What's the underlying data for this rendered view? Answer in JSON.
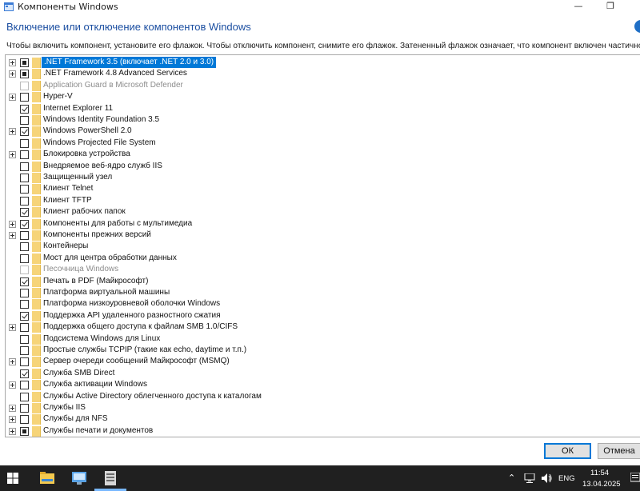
{
  "window": {
    "title": "Компоненты Windows",
    "minimize_glyph": "—",
    "maximize_glyph": "❐"
  },
  "heading": "Включение или отключение компонентов Windows",
  "description": "Чтобы включить компонент, установите его флажок. Чтобы отключить компонент, снимите его флажок. Затененный флажок означает, что компонент включен частично.",
  "features": [
    {
      "label": ".NET Framework 3.5 (включает .NET 2.0 и 3.0)",
      "state": "partial",
      "expandable": true,
      "selected": true,
      "disabled": false
    },
    {
      "label": ".NET Framework 4.8 Advanced Services",
      "state": "partial",
      "expandable": true,
      "selected": false,
      "disabled": false
    },
    {
      "label": "Application Guard в Microsoft Defender",
      "state": "unchecked",
      "expandable": false,
      "selected": false,
      "disabled": true
    },
    {
      "label": "Hyper-V",
      "state": "unchecked",
      "expandable": true,
      "selected": false,
      "disabled": false
    },
    {
      "label": "Internet Explorer 11",
      "state": "checked",
      "expandable": false,
      "selected": false,
      "disabled": false
    },
    {
      "label": "Windows Identity Foundation 3.5",
      "state": "unchecked",
      "expandable": false,
      "selected": false,
      "disabled": false
    },
    {
      "label": "Windows PowerShell 2.0",
      "state": "checked",
      "expandable": true,
      "selected": false,
      "disabled": false
    },
    {
      "label": "Windows Projected File System",
      "state": "unchecked",
      "expandable": false,
      "selected": false,
      "disabled": false
    },
    {
      "label": "Блокировка устройства",
      "state": "unchecked",
      "expandable": true,
      "selected": false,
      "disabled": false
    },
    {
      "label": "Внедряемое веб-ядро служб IIS",
      "state": "unchecked",
      "expandable": false,
      "selected": false,
      "disabled": false
    },
    {
      "label": "Защищенный узел",
      "state": "unchecked",
      "expandable": false,
      "selected": false,
      "disabled": false
    },
    {
      "label": "Клиент Telnet",
      "state": "unchecked",
      "expandable": false,
      "selected": false,
      "disabled": false
    },
    {
      "label": "Клиент TFTP",
      "state": "unchecked",
      "expandable": false,
      "selected": false,
      "disabled": false
    },
    {
      "label": "Клиент рабочих папок",
      "state": "checked",
      "expandable": false,
      "selected": false,
      "disabled": false
    },
    {
      "label": "Компоненты для работы с мультимедиа",
      "state": "checked",
      "expandable": true,
      "selected": false,
      "disabled": false
    },
    {
      "label": "Компоненты прежних версий",
      "state": "unchecked",
      "expandable": true,
      "selected": false,
      "disabled": false
    },
    {
      "label": "Контейнеры",
      "state": "unchecked",
      "expandable": false,
      "selected": false,
      "disabled": false
    },
    {
      "label": "Мост для центра обработки данных",
      "state": "unchecked",
      "expandable": false,
      "selected": false,
      "disabled": false
    },
    {
      "label": "Песочница Windows",
      "state": "unchecked",
      "expandable": false,
      "selected": false,
      "disabled": true
    },
    {
      "label": "Печать в PDF (Майкрософт)",
      "state": "checked",
      "expandable": false,
      "selected": false,
      "disabled": false
    },
    {
      "label": "Платформа виртуальной машины",
      "state": "unchecked",
      "expandable": false,
      "selected": false,
      "disabled": false
    },
    {
      "label": "Платформа низкоуровневой оболочки Windows",
      "state": "unchecked",
      "expandable": false,
      "selected": false,
      "disabled": false
    },
    {
      "label": "Поддержка API удаленного разностного сжатия",
      "state": "checked",
      "expandable": false,
      "selected": false,
      "disabled": false
    },
    {
      "label": "Поддержка общего доступа к файлам SMB 1.0/CIFS",
      "state": "unchecked",
      "expandable": true,
      "selected": false,
      "disabled": false
    },
    {
      "label": "Подсистема Windows для Linux",
      "state": "unchecked",
      "expandable": false,
      "selected": false,
      "disabled": false
    },
    {
      "label": "Простые службы TCPIP (такие как echo, daytime и т.п.)",
      "state": "unchecked",
      "expandable": false,
      "selected": false,
      "disabled": false
    },
    {
      "label": "Сервер очереди сообщений Майкрософт (MSMQ)",
      "state": "unchecked",
      "expandable": true,
      "selected": false,
      "disabled": false
    },
    {
      "label": "Служба SMB Direct",
      "state": "checked",
      "expandable": false,
      "selected": false,
      "disabled": false
    },
    {
      "label": "Служба активации Windows",
      "state": "unchecked",
      "expandable": true,
      "selected": false,
      "disabled": false
    },
    {
      "label": "Службы Active Directory облегченного доступа к каталогам",
      "state": "unchecked",
      "expandable": false,
      "selected": false,
      "disabled": false
    },
    {
      "label": "Службы IIS",
      "state": "unchecked",
      "expandable": true,
      "selected": false,
      "disabled": false
    },
    {
      "label": "Службы для NFS",
      "state": "unchecked",
      "expandable": true,
      "selected": false,
      "disabled": false
    },
    {
      "label": "Службы печати и документов",
      "state": "partial",
      "expandable": true,
      "selected": false,
      "disabled": false
    }
  ],
  "buttons": {
    "ok": "ОК",
    "cancel": "Отмена"
  },
  "taskbar": {
    "language": "ENG",
    "time": "11:54",
    "date": "13.04.2025"
  },
  "colors": {
    "accent": "#0078d7",
    "heading": "#1c4fa1",
    "folder": "#f6d479",
    "taskbar": "#202020"
  }
}
